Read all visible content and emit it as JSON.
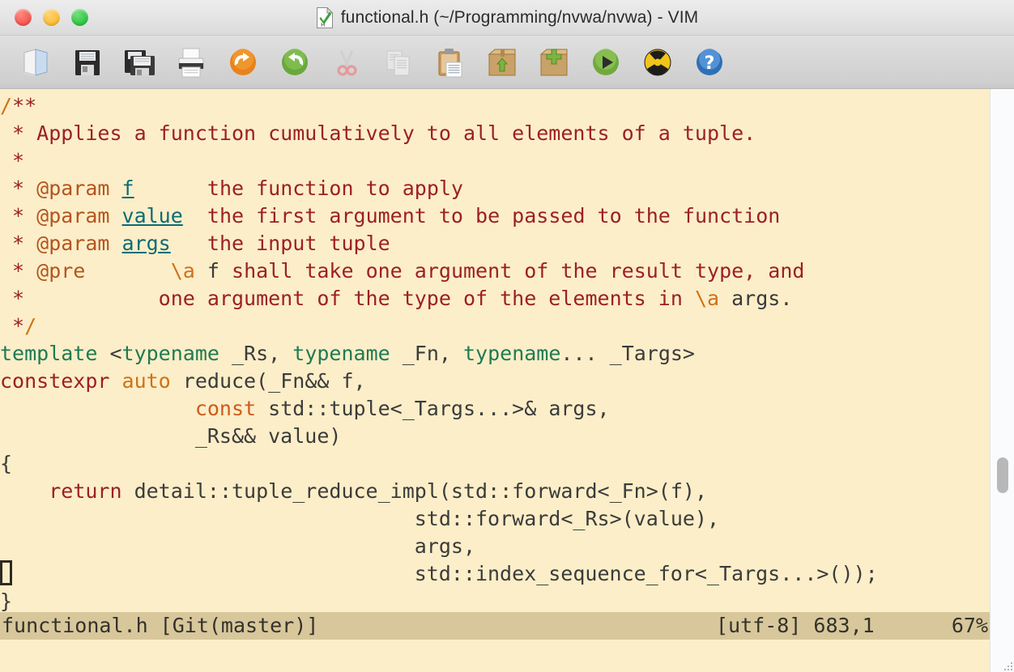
{
  "window": {
    "title": "functional.h (~/Programming/nvwa/nvwa) - VIM",
    "title_icon": "vim-document-icon",
    "traffic": {
      "close_label": "close",
      "minimize_label": "minimize",
      "maximize_label": "maximize"
    },
    "colors": {
      "titlebar_bg": "#e6e6e6",
      "toolbar_bg": "#d6d6d6",
      "editor_bg": "#fbeec8",
      "statusline_bg": "#d7c79b",
      "close": "#f4544d",
      "minimize": "#fbbd2e",
      "maximize": "#2bc540"
    }
  },
  "toolbar": {
    "buttons": [
      {
        "name": "open-file-icon",
        "label": "Open"
      },
      {
        "name": "save-icon",
        "label": "Save"
      },
      {
        "name": "save-all-icon",
        "label": "Save All"
      },
      {
        "name": "print-icon",
        "label": "Print"
      },
      {
        "name": "undo-icon",
        "label": "Undo"
      },
      {
        "name": "redo-icon",
        "label": "Redo"
      },
      {
        "name": "cut-icon",
        "label": "Cut"
      },
      {
        "name": "copy-icon",
        "label": "Copy"
      },
      {
        "name": "paste-icon",
        "label": "Paste"
      },
      {
        "name": "load-session-icon",
        "label": "Load Session"
      },
      {
        "name": "save-session-icon",
        "label": "Save Session"
      },
      {
        "name": "run-script-icon",
        "label": "Run Script"
      },
      {
        "name": "make-icon",
        "label": "Make"
      },
      {
        "name": "help-icon",
        "label": "Help"
      }
    ]
  },
  "editor": {
    "lines": [
      [
        {
          "t": "/",
          "c": "c-cdelim"
        },
        {
          "t": "**",
          "c": "c-comment"
        }
      ],
      [
        {
          "t": " * Applies a function cumulatively to all elements of a tuple.",
          "c": "c-comment"
        }
      ],
      [
        {
          "t": " *",
          "c": "c-comment"
        }
      ],
      [
        {
          "t": " * ",
          "c": "c-comment"
        },
        {
          "t": "@param",
          "c": "c-param"
        },
        {
          "t": " ",
          "c": "c-comment"
        },
        {
          "t": "f",
          "c": "c-ident"
        },
        {
          "t": "      the function to apply",
          "c": "c-comment"
        }
      ],
      [
        {
          "t": " * ",
          "c": "c-comment"
        },
        {
          "t": "@param",
          "c": "c-param"
        },
        {
          "t": " ",
          "c": "c-comment"
        },
        {
          "t": "value",
          "c": "c-ident"
        },
        {
          "t": "  the first argument to be passed to the function",
          "c": "c-comment"
        }
      ],
      [
        {
          "t": " * ",
          "c": "c-comment"
        },
        {
          "t": "@param",
          "c": "c-param"
        },
        {
          "t": " ",
          "c": "c-comment"
        },
        {
          "t": "args",
          "c": "c-ident"
        },
        {
          "t": "   the input tuple",
          "c": "c-comment"
        }
      ],
      [
        {
          "t": " * ",
          "c": "c-comment"
        },
        {
          "t": "@pre",
          "c": "c-param"
        },
        {
          "t": "       ",
          "c": "c-comment"
        },
        {
          "t": "\\a",
          "c": "c-cdelim"
        },
        {
          "t": " ",
          "c": "c-comment"
        },
        {
          "t": "f",
          "c": "c-emph"
        },
        {
          "t": " shall take one argument of the result type, and",
          "c": "c-comment"
        }
      ],
      [
        {
          "t": " *           one argument of the type of the elements in ",
          "c": "c-comment"
        },
        {
          "t": "\\a",
          "c": "c-cdelim"
        },
        {
          "t": " ",
          "c": "c-comment"
        },
        {
          "t": "args.",
          "c": "c-emph"
        }
      ],
      [
        {
          "t": " *",
          "c": "c-comment"
        },
        {
          "t": "/",
          "c": "c-cdelim"
        }
      ],
      [
        {
          "t": "template",
          "c": "c-kw-green"
        },
        {
          "t": " <",
          "c": "c-plain"
        },
        {
          "t": "typename",
          "c": "c-kw-green"
        },
        {
          "t": " _Rs, ",
          "c": "c-plain"
        },
        {
          "t": "typename",
          "c": "c-kw-green"
        },
        {
          "t": " _Fn, ",
          "c": "c-plain"
        },
        {
          "t": "typename",
          "c": "c-kw-green"
        },
        {
          "t": "... _Targs>",
          "c": "c-plain"
        }
      ],
      [
        {
          "t": "constexpr",
          "c": "c-kw-red"
        },
        {
          "t": " ",
          "c": "c-plain"
        },
        {
          "t": "auto",
          "c": "c-type"
        },
        {
          "t": " reduce(_Fn&& f,",
          "c": "c-plain"
        }
      ],
      [
        {
          "t": "                ",
          "c": "c-plain"
        },
        {
          "t": "const",
          "c": "c-const"
        },
        {
          "t": " std::tuple<_Targs...>& args,",
          "c": "c-plain"
        }
      ],
      [
        {
          "t": "                _Rs&& value)",
          "c": "c-plain"
        }
      ],
      [
        {
          "t": "{",
          "c": "c-plain"
        }
      ],
      [
        {
          "t": "    ",
          "c": "c-plain"
        },
        {
          "t": "return",
          "c": "c-kw-red"
        },
        {
          "t": " detail::tuple_reduce_impl(std::forward<_Fn>(f),",
          "c": "c-plain"
        }
      ],
      [
        {
          "t": "                                  std::forward<_Rs>(value),",
          "c": "c-plain"
        }
      ],
      [
        {
          "t": "                                  args,",
          "c": "c-plain"
        }
      ],
      [
        {
          "t": "CURSOR",
          "c": "cursor"
        },
        {
          "t": "                                 std::index_sequence_for<_Targs...>());",
          "c": "c-plain"
        }
      ],
      [
        {
          "t": "}",
          "c": "c-plain"
        }
      ]
    ]
  },
  "statusline": {
    "file": "functional.h [Git(master)]",
    "encoding": "[utf-8] 683,1",
    "percent": "67%"
  },
  "scrollbar": {
    "thumb_position_percent": 63
  }
}
